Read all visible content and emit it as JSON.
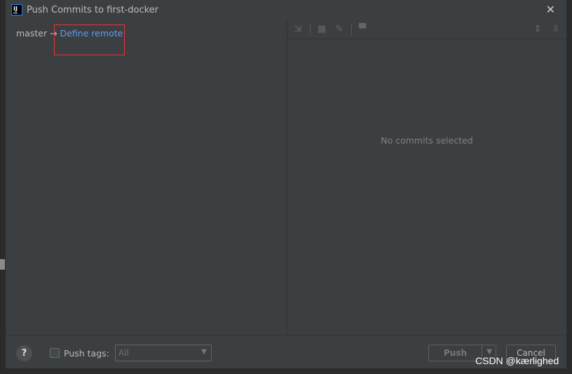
{
  "window": {
    "title": "Push Commits to first-docker",
    "logo_text": "IJ"
  },
  "left": {
    "branch": "master",
    "arrow": "→",
    "remote_link": "Define remote"
  },
  "right": {
    "toolbar_icons": [
      "merge-arrows-icon",
      "group-by-icon",
      "edit-icon",
      "preview-icon",
      "expand-all-icon",
      "collapse-all-icon"
    ],
    "empty_text": "No commits selected"
  },
  "bottom": {
    "help": "?",
    "push_tags_label": "Push tags:",
    "push_tags_checked": false,
    "tags_select": "All",
    "push_label": "Push",
    "cancel_label": "Cancel"
  },
  "watermark": "CSDN @kærlighed",
  "colors": {
    "background": "#3c3f41",
    "link": "#589df6",
    "highlight_box": "#ee3333"
  }
}
